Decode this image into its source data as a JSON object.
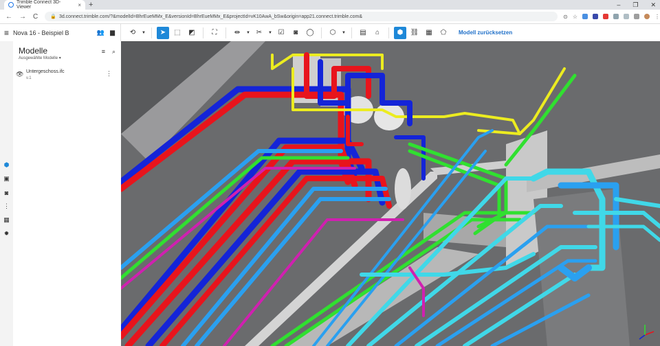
{
  "browser": {
    "tab_title": "Trimble Connect 3D-Viewer",
    "tab_close": "×",
    "new_tab": "+",
    "win_min": "–",
    "win_max": "❐",
    "win_close": "✕",
    "nav_back": "←",
    "nav_forward": "→",
    "nav_reload": "C",
    "url": "3d.connect.trimble.com/?&modelId=BhrEueMMx_E&versionId=BhrEueMMx_E&projectId=vK10AwA_bSw&origin=app21.connect.trimble.com&"
  },
  "toolbar": {
    "menu_icon": "≡",
    "project_name": "Nova 16 - Beispiel B",
    "reset_label": "Modell zurücksetzen"
  },
  "panel": {
    "title": "Modelle",
    "subtitle": "Ausgewählte Modelle",
    "model_name": "Untergeschoss.ifc",
    "model_version": "v.1"
  },
  "colors": {
    "accent": "#1e88d8",
    "pipe_red": "#e8141c",
    "pipe_blue": "#1424d8",
    "pipe_green": "#30e030",
    "pipe_cyan": "#40d8e8",
    "pipe_lightblue": "#2aa0f0",
    "pipe_yellow": "#ecec20",
    "pipe_magenta": "#d020b0"
  }
}
